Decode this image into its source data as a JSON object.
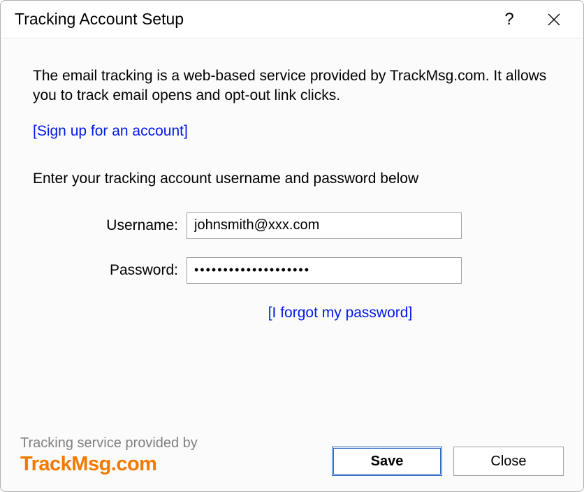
{
  "titlebar": {
    "title": "Tracking Account Setup",
    "help": "?"
  },
  "content": {
    "intro": "The email tracking is a web-based service provided by TrackMsg.com. It allows you to track email opens and opt-out link clicks.",
    "signup_link": "[Sign up for an account]",
    "instruction": "Enter your tracking account username and password below",
    "username_label": "Username:",
    "username_value": "johnsmith@xxx.com",
    "password_label": "Password:",
    "password_value": "••••••••••••••••••••",
    "forgot_link": "[I forgot my password]"
  },
  "footer": {
    "provider_label": "Tracking service provided by",
    "provider_logo": "TrackMsg.com",
    "save_label": "Save",
    "close_label": "Close"
  }
}
